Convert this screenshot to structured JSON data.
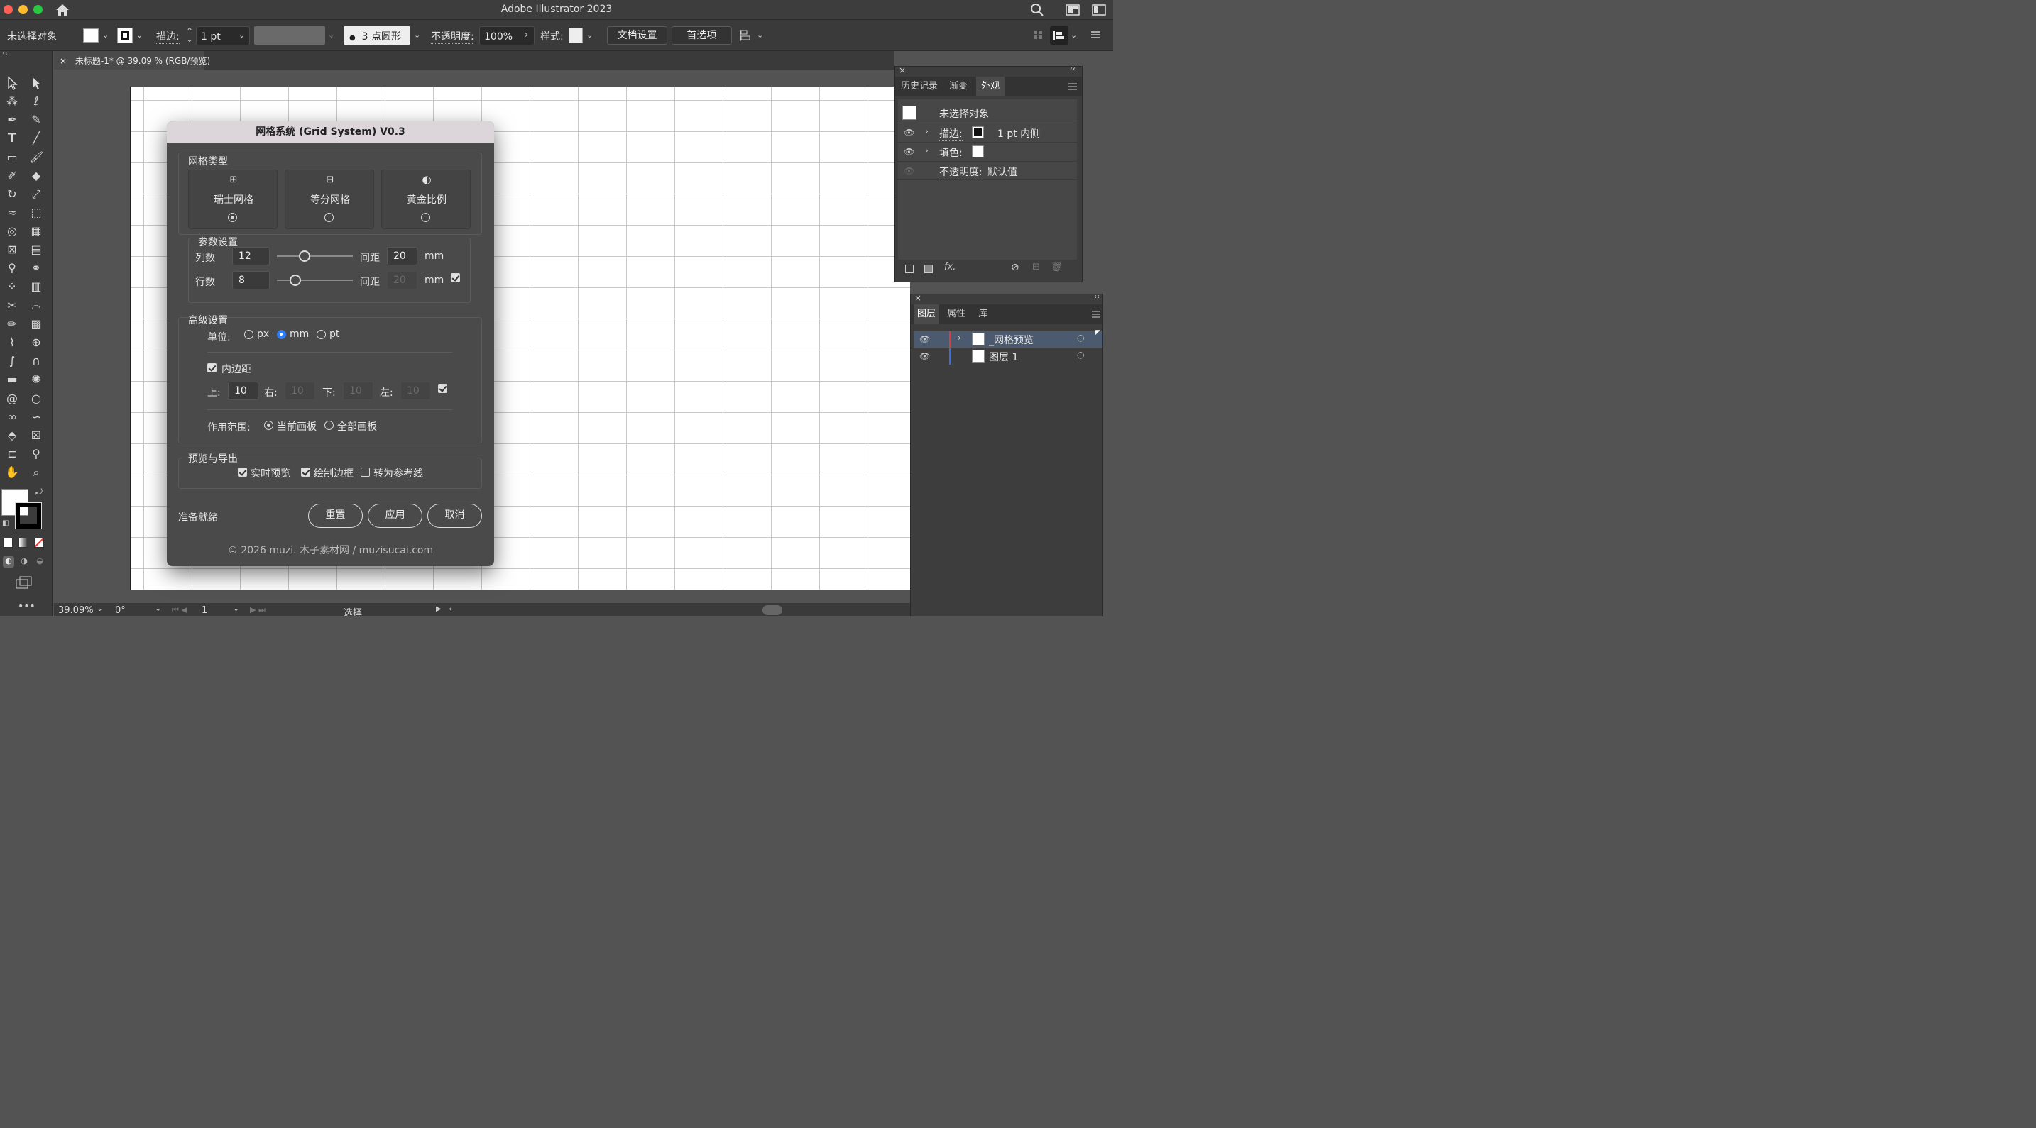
{
  "app": {
    "title": "Adobe Illustrator 2023"
  },
  "colors": {
    "accent_blue": "#2d7ef7",
    "layer_red": "#e03a3a",
    "layer_blue": "#3a6ee0",
    "dialog_title_bg": "#dcd6da",
    "selected_row": "#4b5a6e"
  },
  "control_bar": {
    "selection_label": "未选择对象",
    "stroke_label": "描边:",
    "stroke_value": "1 pt",
    "brush_label": "3 点圆形",
    "opacity_label": "不透明度:",
    "opacity_value": "100%",
    "style_label": "样式:",
    "doc_setup_button": "文档设置",
    "preferences_button": "首选项"
  },
  "document_tab": {
    "title": "未标题-1* @ 39.09 % (RGB/预览)",
    "close": "×"
  },
  "status_bar": {
    "zoom": "39.09%",
    "rotation": "0°",
    "artboard": "1",
    "tool": "选择"
  },
  "dialog": {
    "title": "网格系统 (Grid System) V0.3",
    "grid_type": {
      "heading": "网格类型",
      "options": [
        {
          "icon": "⊞",
          "label": "瑞士网格",
          "selected": true
        },
        {
          "icon": "⊟",
          "label": "等分网格",
          "selected": false
        },
        {
          "icon": "◐",
          "label": "黄金比例",
          "selected": false
        }
      ]
    },
    "params": {
      "heading": "参数设置",
      "columns_label": "列数",
      "columns_value": "12",
      "columns_gap_label": "间距",
      "columns_gap_value": "20",
      "columns_unit": "mm",
      "rows_label": "行数",
      "rows_value": "8",
      "rows_gap_label": "间距",
      "rows_gap_value": "20",
      "rows_unit": "mm",
      "columns_slider": 0.36,
      "rows_slider": 0.24,
      "link_gap_checked": true
    },
    "advanced": {
      "heading": "高级设置",
      "unit_label": "单位:",
      "units": [
        "px",
        "mm",
        "pt"
      ],
      "selected_unit": "mm",
      "padding_label": "内边距",
      "padding_checked": true,
      "top_label": "上:",
      "top_value": "10",
      "right_label": "右:",
      "right_value": "10",
      "bottom_label": "下:",
      "bottom_value": "10",
      "left_label": "左:",
      "left_value": "10",
      "link_padding_checked": true,
      "scope_label": "作用范围:",
      "scope_current": "当前画板",
      "scope_all": "全部画板",
      "scope_selected": "current"
    },
    "preview": {
      "heading": "预览与导出",
      "live_preview": "实时预览",
      "live_preview_checked": true,
      "draw_border": "绘制边框",
      "draw_border_checked": true,
      "to_guides": "转为参考线",
      "to_guides_checked": false
    },
    "status": "准备就绪",
    "buttons": {
      "reset": "重置",
      "apply": "应用",
      "cancel": "取消"
    },
    "footer": "© 2026 muzi. 木子素材网 / muzisucai.com"
  },
  "appearance_panel": {
    "tabs": [
      "历史记录",
      "渐变",
      "外观"
    ],
    "active_tab": "外观",
    "object_label": "未选择对象",
    "stroke_label": "描边:",
    "stroke_value": "1 pt 内侧",
    "fill_label": "填色:",
    "opacity_label": "不透明度:",
    "opacity_value": "默认值",
    "fx_label": "fx."
  },
  "layers_panel": {
    "tabs": [
      "图层",
      "属性",
      "库"
    ],
    "active_tab": "图层",
    "layers": [
      {
        "name": "_网格预览",
        "color": "#e03a3a",
        "selected": true
      },
      {
        "name": "图层 1",
        "color": "#3a6ee0",
        "selected": false
      }
    ]
  }
}
